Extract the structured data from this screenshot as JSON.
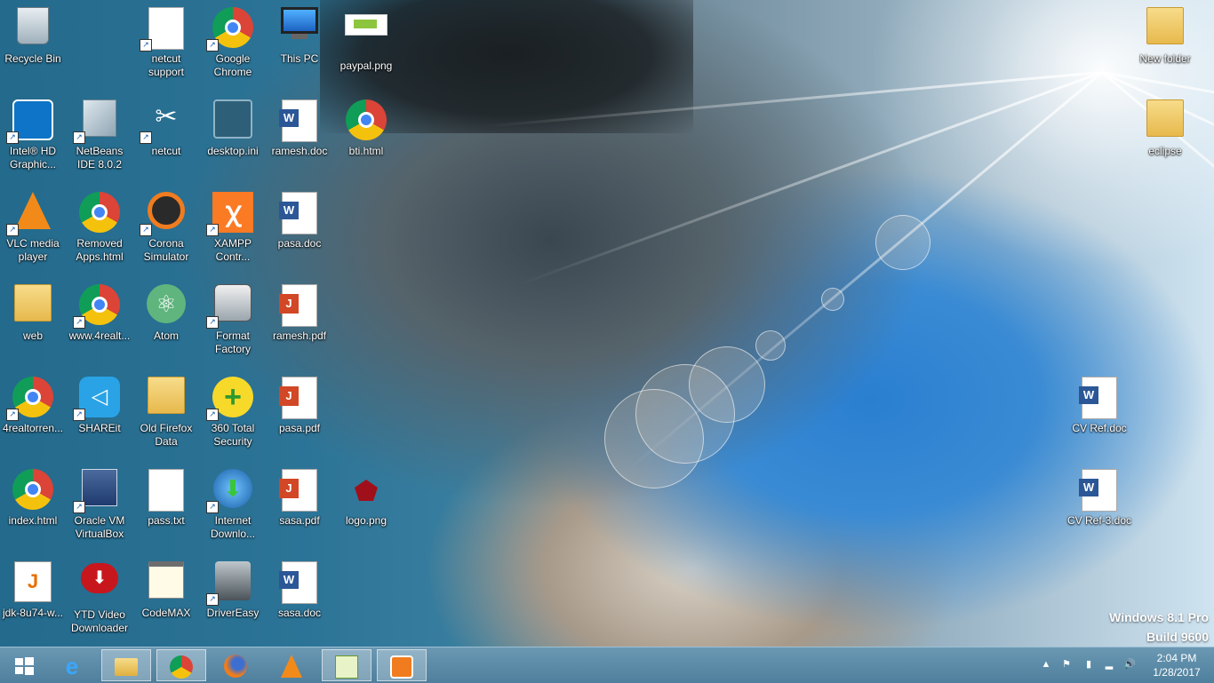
{
  "desktop": {
    "icons": [
      {
        "label": "Recycle Bin",
        "icon": "recycle-bin-icon"
      },
      {
        "label": "netcut support",
        "icon": "file-icon"
      },
      {
        "label": "Google Chrome",
        "icon": "chrome-icon"
      },
      {
        "label": "This PC",
        "icon": "computer-icon"
      },
      {
        "label": "paypal.png",
        "icon": "image-icon"
      },
      {
        "label": "Intel® HD Graphic...",
        "icon": "intel-icon"
      },
      {
        "label": "NetBeans IDE 8.0.2",
        "icon": "netbeans-icon"
      },
      {
        "label": "netcut",
        "icon": "netcut-icon"
      },
      {
        "label": "desktop.ini",
        "icon": "settings-file-icon"
      },
      {
        "label": "ramesh.doc",
        "icon": "word-doc-icon"
      },
      {
        "label": "bti.html",
        "icon": "chrome-icon"
      },
      {
        "label": "VLC media player",
        "icon": "vlc-icon"
      },
      {
        "label": "Removed Apps.html",
        "icon": "chrome-icon"
      },
      {
        "label": "Corona Simulator",
        "icon": "corona-icon"
      },
      {
        "label": "XAMPP Contr...",
        "icon": "xampp-icon"
      },
      {
        "label": "pasa.doc",
        "icon": "word-doc-icon"
      },
      {
        "label": "web",
        "icon": "folder-icon"
      },
      {
        "label": "www.4realt...",
        "icon": "chrome-icon"
      },
      {
        "label": "Atom",
        "icon": "atom-icon"
      },
      {
        "label": "Format Factory",
        "icon": "format-factory-icon"
      },
      {
        "label": "ramesh.pdf",
        "icon": "pdf-icon"
      },
      {
        "label": "4realtorren...",
        "icon": "chrome-icon"
      },
      {
        "label": "SHAREit",
        "icon": "shareit-icon"
      },
      {
        "label": "Old Firefox Data",
        "icon": "folder-icon"
      },
      {
        "label": "360 Total Security",
        "icon": "security-icon"
      },
      {
        "label": "pasa.pdf",
        "icon": "pdf-icon"
      },
      {
        "label": "index.html",
        "icon": "chrome-icon"
      },
      {
        "label": "Oracle VM VirtualBox",
        "icon": "virtualbox-icon"
      },
      {
        "label": "pass.txt",
        "icon": "text-file-icon"
      },
      {
        "label": "Internet Downlo...",
        "icon": "idm-icon"
      },
      {
        "label": "sasa.pdf",
        "icon": "pdf-icon"
      },
      {
        "label": "logo.png",
        "icon": "pentagon-image-icon"
      },
      {
        "label": "jdk-8u74-w...",
        "icon": "java-icon"
      },
      {
        "label": "YTD Video Downloader",
        "icon": "ytd-icon"
      },
      {
        "label": "CodeMAX",
        "icon": "notepad-icon"
      },
      {
        "label": "DriverEasy",
        "icon": "drivereasy-icon"
      },
      {
        "label": "sasa.doc",
        "icon": "word-doc-icon"
      },
      {
        "label": "New folder",
        "icon": "folder-icon"
      },
      {
        "label": "eclipse",
        "icon": "folder-icon"
      },
      {
        "label": "CV Ref.doc",
        "icon": "word-doc-icon"
      },
      {
        "label": "CV Ref-3.doc",
        "icon": "word-doc-icon"
      }
    ],
    "watermark": {
      "line1": "Windows 8.1 Pro",
      "line2": "Build 9600"
    }
  },
  "taskbar": {
    "start": "windows-start-icon",
    "apps": [
      {
        "name": "Internet Explorer",
        "icon": "ie-icon"
      },
      {
        "name": "File Explorer",
        "icon": "file-explorer-icon"
      },
      {
        "name": "Google Chrome",
        "icon": "chrome-icon"
      },
      {
        "name": "Firefox",
        "icon": "firefox-icon"
      },
      {
        "name": "VLC media player",
        "icon": "vlc-icon"
      },
      {
        "name": "Notepad++",
        "icon": "notepadpp-icon"
      },
      {
        "name": "Media player",
        "icon": "media-player-icon"
      }
    ],
    "clock": {
      "time": "2:04 PM",
      "date": "1/28/2017"
    }
  }
}
